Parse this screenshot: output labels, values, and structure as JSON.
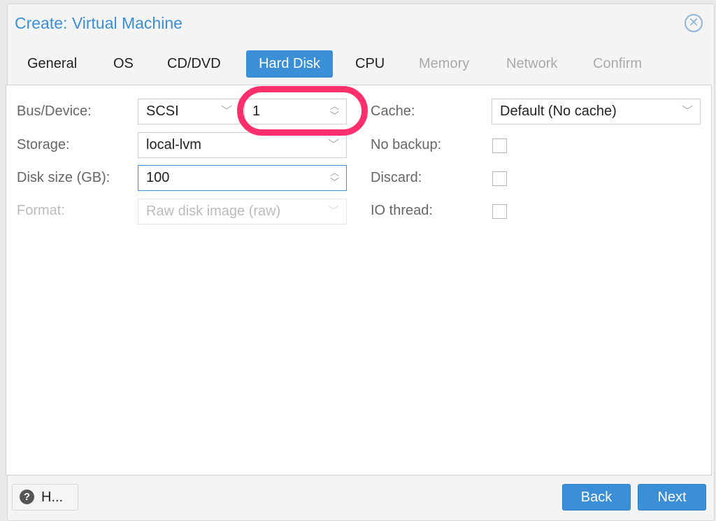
{
  "dialog": {
    "title": "Create: Virtual Machine",
    "close_icon": "close-circle-icon"
  },
  "tabs": [
    {
      "label": "General",
      "state": "normal"
    },
    {
      "label": "OS",
      "state": "normal"
    },
    {
      "label": "CD/DVD",
      "state": "normal"
    },
    {
      "label": "Hard Disk",
      "state": "active"
    },
    {
      "label": "CPU",
      "state": "normal"
    },
    {
      "label": "Memory",
      "state": "disabled"
    },
    {
      "label": "Network",
      "state": "disabled"
    },
    {
      "label": "Confirm",
      "state": "disabled"
    }
  ],
  "form": {
    "bus_device": {
      "label": "Bus/Device:",
      "bus": "SCSI",
      "device": "1"
    },
    "storage": {
      "label": "Storage:",
      "value": "local-lvm"
    },
    "disk_size": {
      "label": "Disk size (GB):",
      "value": "100"
    },
    "format": {
      "label": "Format:",
      "value": "Raw disk image (raw)",
      "disabled": true
    },
    "cache": {
      "label": "Cache:",
      "value": "Default (No cache)"
    },
    "no_backup": {
      "label": "No backup:",
      "checked": false
    },
    "discard": {
      "label": "Discard:",
      "checked": false
    },
    "io_thread": {
      "label": "IO thread:",
      "checked": false
    }
  },
  "footer": {
    "help": "H...",
    "back": "Back",
    "next": "Next"
  },
  "annotation": {
    "color": "#ff2f6e"
  },
  "colors": {
    "accent": "#3a8fd6"
  }
}
